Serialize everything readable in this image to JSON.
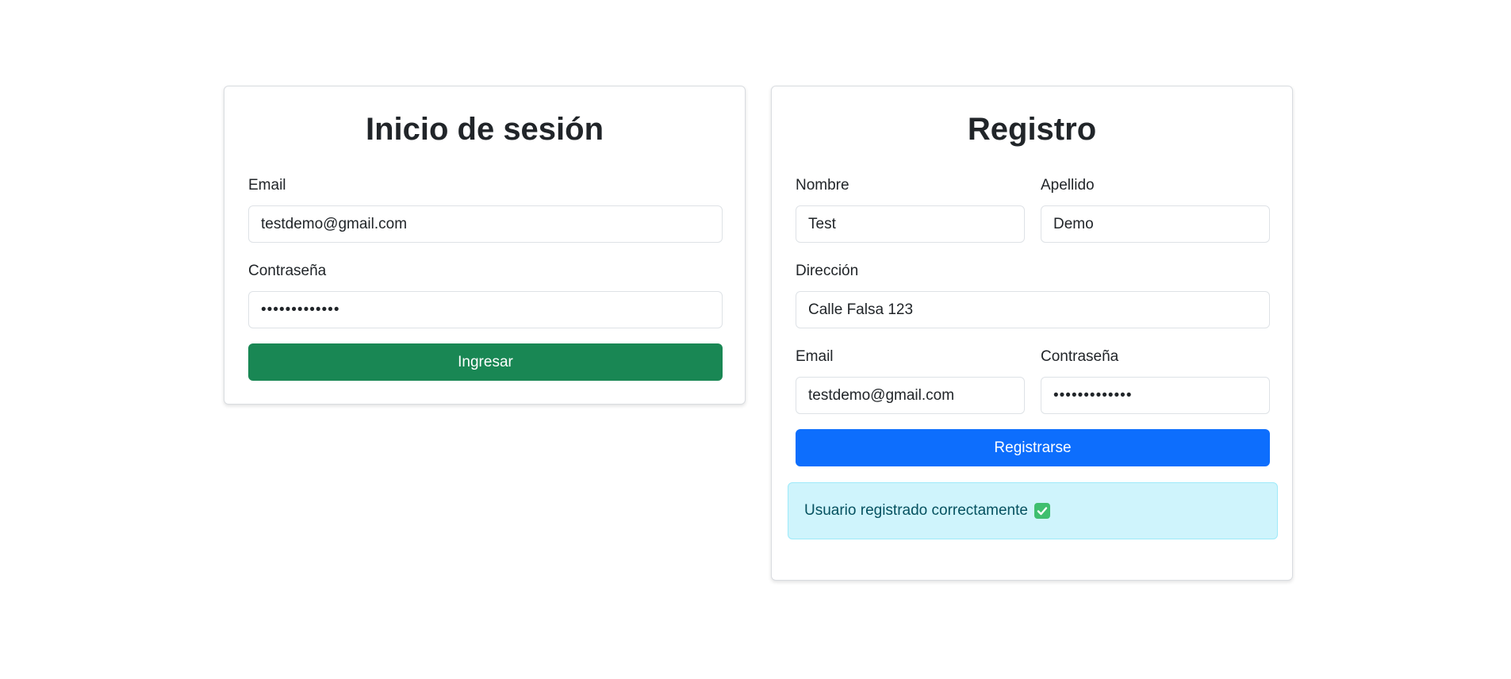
{
  "colors": {
    "login_button": "#198754",
    "register_button": "#0d6efd",
    "alert_background": "#cff4fc",
    "alert_text": "#055160",
    "check_icon": "#3fbf6f"
  },
  "login": {
    "title": "Inicio de sesión",
    "email_label": "Email",
    "email_value": "testdemo@gmail.com",
    "password_label": "Contraseña",
    "password_value": "•••••••••••••",
    "submit_label": "Ingresar"
  },
  "register": {
    "title": "Registro",
    "first_name_label": "Nombre",
    "first_name_value": "Test",
    "last_name_label": "Apellido",
    "last_name_value": "Demo",
    "address_label": "Dirección",
    "address_value": "Calle Falsa 123",
    "email_label": "Email",
    "email_value": "testdemo@gmail.com",
    "password_label": "Contraseña",
    "password_value": "•••••••••••••",
    "submit_label": "Registrarse"
  },
  "alert": {
    "message": "Usuario registrado correctamente",
    "icon": "check-mark-icon"
  }
}
